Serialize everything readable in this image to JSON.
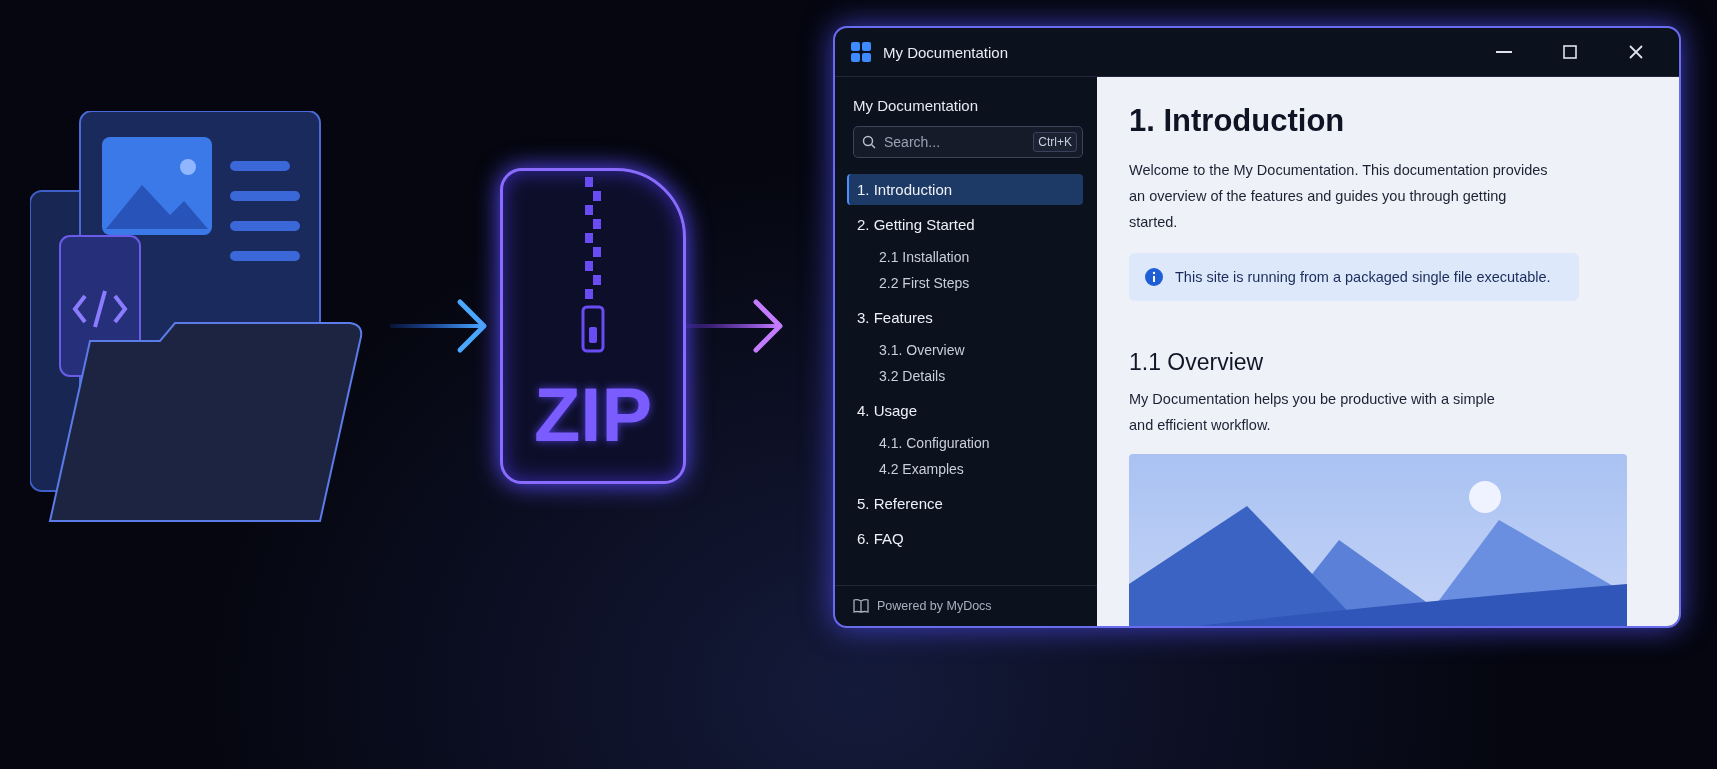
{
  "illustration": {
    "zip_label": "ZIP"
  },
  "window": {
    "title": "My Documentation"
  },
  "sidebar": {
    "heading": "My Documentation",
    "search": {
      "placeholder": "Search...",
      "shortcut": "Ctrl+K"
    },
    "items": [
      {
        "label": "1. Introduction",
        "selected": true
      },
      {
        "label": "2. Getting Started",
        "selected": false,
        "children": [
          {
            "label": "2.1 Installation",
            "selected": false
          },
          {
            "label": "2.2 First Steps",
            "selected": false
          }
        ]
      },
      {
        "label": "3. Features",
        "selected": false,
        "children": [
          {
            "label": "3.1. Overview",
            "selected": false
          },
          {
            "label": "3.2 Details",
            "selected": false
          }
        ]
      },
      {
        "label": "4. Usage",
        "selected": false,
        "children": [
          {
            "label": "4.1. Configuration",
            "selected": false
          },
          {
            "label": "4.2 Examples",
            "selected": false
          }
        ]
      },
      {
        "label": "5. Reference",
        "selected": false
      },
      {
        "label": "6. FAQ",
        "selected": false
      }
    ],
    "footer": "Powered by MyDocs"
  },
  "content": {
    "title": "1. Introduction",
    "intro": "Welcome to the My Documentation. This documentation provides an overview of the features and guides you through getting started.",
    "note": "This site is running from a packaged single file executable.",
    "section_title": "1.1 Overview",
    "section_text": "My Documentation helps you be productive with a simple and efficient workflow."
  }
}
